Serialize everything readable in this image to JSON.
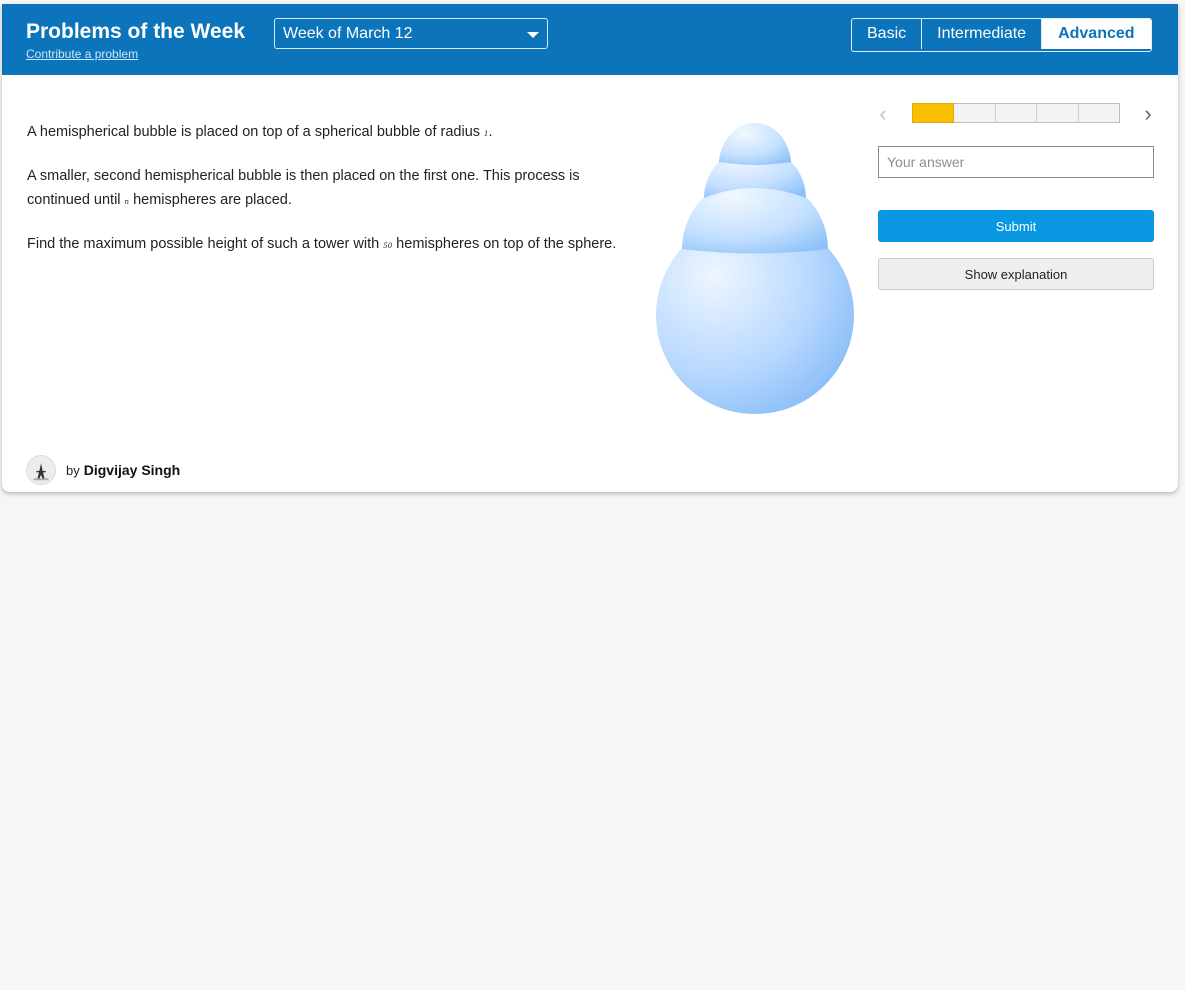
{
  "header": {
    "title": "Problems of the Week",
    "contribute_link": "Contribute a problem",
    "week_select": {
      "selected": "Week of March 12"
    },
    "levels": [
      {
        "label": "Basic",
        "active": false
      },
      {
        "label": "Intermediate",
        "active": true
      },
      {
        "label": "Advanced",
        "active": true
      }
    ]
  },
  "problem": {
    "p1_before": "A hemispherical bubble is placed on top of a spherical bubble of radius ",
    "p1_math": "1",
    "p1_after": ".",
    "p2_before": "A smaller, second hemispherical bubble is then placed on the first one. This process is continued until ",
    "p2_math": "n",
    "p2_after": " hemispheres are placed.",
    "p3_before": "Find the maximum possible height of such a tower with ",
    "p3_math": "50",
    "p3_after": " hemispheres on top of the sphere."
  },
  "sidebar": {
    "prev_icon": "chevron-left-icon",
    "next_icon": "chevron-right-icon",
    "progress": {
      "current": 1,
      "total": 5
    },
    "answer_placeholder": "Your answer",
    "submit_label": "Submit",
    "explanation_label": "Show explanation"
  },
  "author": {
    "by_label": "by",
    "name": "Digvijay Singh",
    "avatar_icon": "eiffel-tower-avatar"
  },
  "colors": {
    "header_bg": "#0b74ba",
    "page_bg": "#f6f6f6",
    "submit_bg": "#0a97e2",
    "progress_fill": "#f9c000"
  }
}
